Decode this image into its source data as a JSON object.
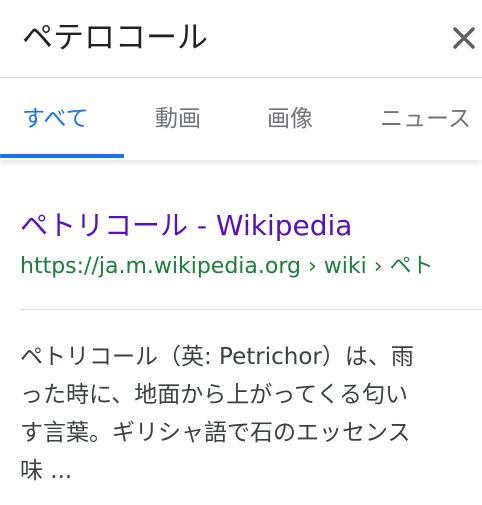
{
  "search": {
    "query": "ペテロコール"
  },
  "tabs": [
    {
      "label": "すべて",
      "active": true
    },
    {
      "label": "動画",
      "active": false
    },
    {
      "label": "画像",
      "active": false
    },
    {
      "label": "ニュース",
      "active": false
    }
  ],
  "result": {
    "title": "ペトリコール - Wikipedia",
    "url": "https://ja.m.wikipedia.org › wiki › ペト",
    "snippet_lines": [
      "ペトリコール（英: Petrichor）は、雨",
      "った時に、地面から上がってくる匂い",
      "す言葉。ギリシャ語で石のエッセンス",
      "味 ..."
    ]
  },
  "colors": {
    "accent": "#1a73e8",
    "visited_link": "#5a0fbf",
    "url_green": "#188038",
    "tab_inactive": "#70757a"
  },
  "icons": {
    "clear": "close-icon"
  }
}
